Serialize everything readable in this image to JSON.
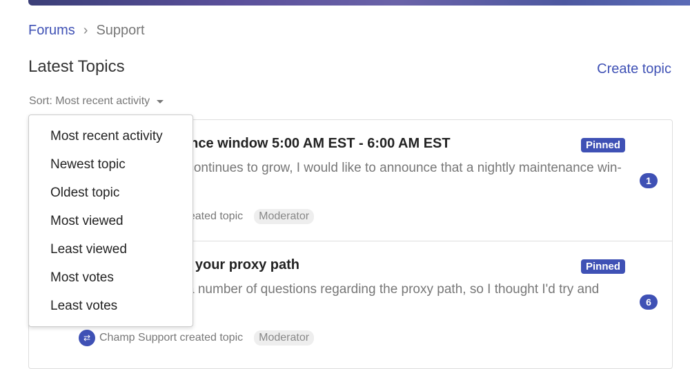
{
  "breadcrumb": {
    "root": "Forums",
    "current": "Support"
  },
  "page_title": "Latest Topics",
  "create_topic": "Create topic",
  "sort": {
    "label": "Sort: Most recent activity",
    "options": [
      "Most recent activity",
      "Newest topic",
      "Oldest topic",
      "Most viewed",
      "Least viewed",
      "Most votes",
      "Least votes"
    ]
  },
  "topics": [
    {
      "title": "Nightly maintenance window 5:00 AM EST - 6:00 AM EST",
      "excerpt": "As our community continues to grow, I would like to announce that a nightly maintenance win-",
      "badge": "Pinned",
      "count": "1",
      "author_line": "Champ Support created topic",
      "role": "Moderator"
    },
    {
      "title": "How to configure your proxy path",
      "excerpt": "We have received a number of questions regarding the proxy path, so I thought I'd try and",
      "badge": "Pinned",
      "count": "6",
      "author_line": "Champ Support created topic",
      "role": "Moderator"
    }
  ],
  "colors": {
    "accent": "#3f51b5"
  }
}
